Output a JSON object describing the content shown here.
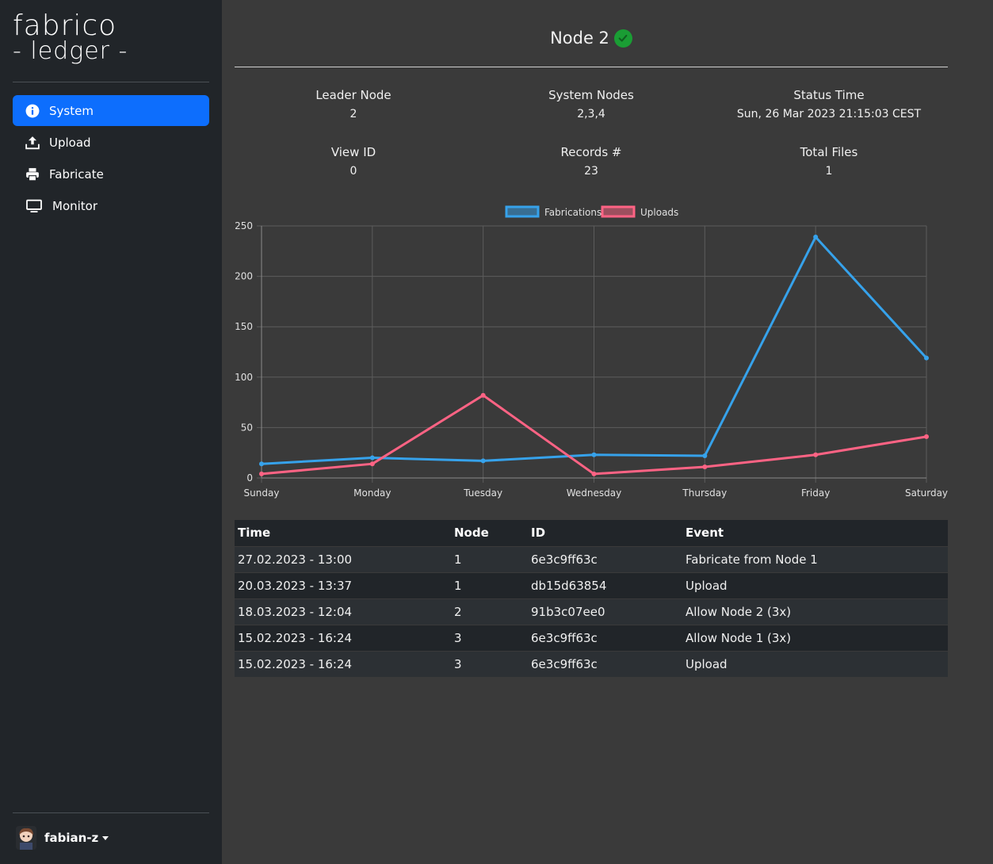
{
  "brand": {
    "line1": "fabrico",
    "line2": "- ledger -"
  },
  "sidebar": {
    "items": [
      {
        "label": "System",
        "icon": "info-circle-icon",
        "active": true
      },
      {
        "label": "Upload",
        "icon": "upload-icon",
        "active": false
      },
      {
        "label": "Fabricate",
        "icon": "printer-icon",
        "active": false
      },
      {
        "label": "Monitor",
        "icon": "monitor-icon",
        "active": false
      }
    ],
    "user": {
      "name": "fabian-z"
    }
  },
  "header": {
    "title": "Node 2",
    "status_icon": "check-circle-icon",
    "status_color": "#1a9d34"
  },
  "stats": [
    {
      "label": "Leader Node",
      "value": "2"
    },
    {
      "label": "System Nodes",
      "value": "2,3,4"
    },
    {
      "label": "Status Time",
      "value": "Sun, 26 Mar 2023 21:15:03 CEST"
    },
    {
      "label": "View ID",
      "value": "0"
    },
    {
      "label": "Records #",
      "value": "23"
    },
    {
      "label": "Total Files",
      "value": "1"
    }
  ],
  "chart_data": {
    "type": "line",
    "categories": [
      "Sunday",
      "Monday",
      "Tuesday",
      "Wednesday",
      "Thursday",
      "Friday",
      "Saturday"
    ],
    "series": [
      {
        "name": "Fabrications",
        "color": "#36a2eb",
        "values": [
          14,
          20,
          17,
          23,
          22,
          239,
          119
        ]
      },
      {
        "name": "Uploads",
        "color": "#ff6384",
        "values": [
          4,
          14,
          82,
          4,
          11,
          23,
          41
        ]
      }
    ],
    "ylim": [
      0,
      250
    ],
    "yticks": [
      0,
      50,
      100,
      150,
      200,
      250
    ],
    "legend": "top-center",
    "grid": true
  },
  "events": {
    "headers": [
      "Time",
      "Node",
      "ID",
      "Event"
    ],
    "rows": [
      [
        "27.02.2023 - 13:00",
        "1",
        "6e3c9ff63c",
        "Fabricate from Node 1"
      ],
      [
        "20.03.2023 - 13:37",
        "1",
        "db15d63854",
        "Upload"
      ],
      [
        "18.03.2023 - 12:04",
        "2",
        "91b3c07ee0",
        "Allow Node 2 (3x)"
      ],
      [
        "15.02.2023 - 16:24",
        "3",
        "6e3c9ff63c",
        "Allow Node 1 (3x)"
      ],
      [
        "15.02.2023 - 16:24",
        "3",
        "6e3c9ff63c",
        "Upload"
      ]
    ]
  }
}
